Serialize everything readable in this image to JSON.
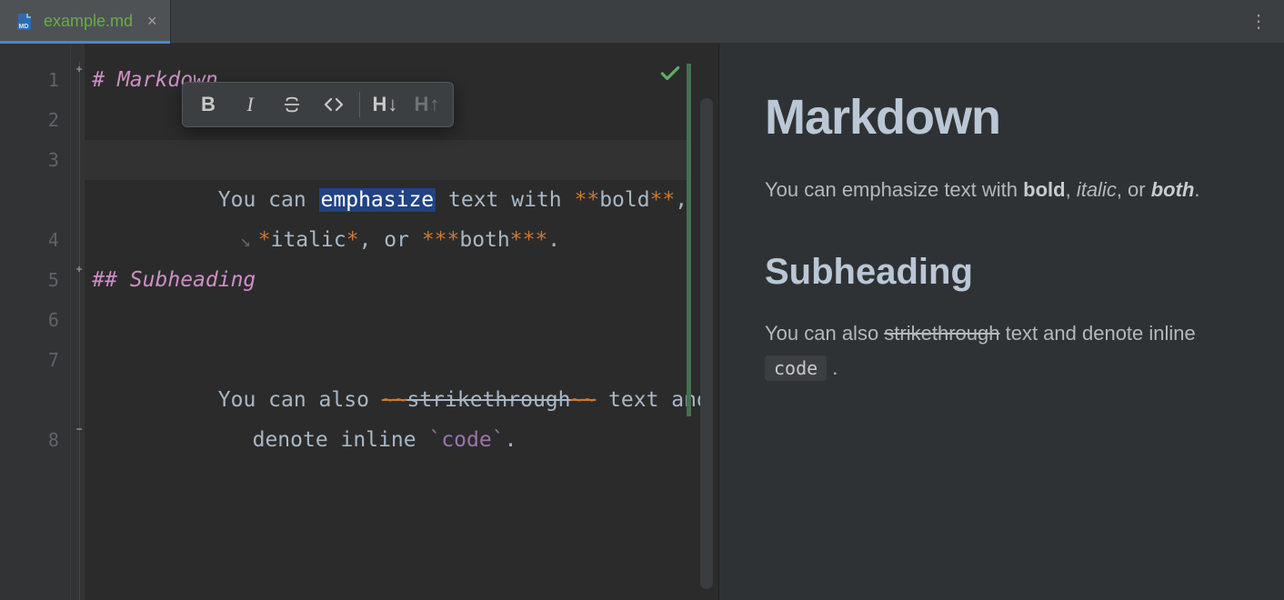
{
  "tabbar": {
    "file_name": "example.md"
  },
  "toolbar": {
    "bold": "B",
    "italic": "I",
    "strike": "S",
    "code": "<>",
    "h_down": "H↓",
    "h_up": "H↑"
  },
  "editor": {
    "line_numbers": [
      "1",
      "2",
      "3",
      "4",
      "5",
      "6",
      "7",
      "8"
    ],
    "line1_heading": "# Markdown",
    "line3a_pre": "You can ",
    "line3a_sel": "emphasize",
    "line3a_mid": " text with ",
    "line3a_mk1": "**",
    "line3a_bold": "bold",
    "line3a_mk2": "**",
    "line3a_tail": ",",
    "line3b_mk1": "*",
    "line3b_italic": "italic",
    "line3b_mk2": "*",
    "line3b_mid": ", or ",
    "line3b_mk3": "***",
    "line3b_both": "both",
    "line3b_mk4": "***",
    "line3b_tail": ".",
    "line5_heading": "## Subheading",
    "line7a_pre": "You can also ",
    "line7a_mk1": "~~",
    "line7a_strike": "strikethrough",
    "line7a_mk2": "~~",
    "line7a_tail": " text and",
    "line7b_pre": " denote inline ",
    "line7b_mk1": "`",
    "line7b_code": "code",
    "line7b_mk2": "`",
    "line7b_tail": "."
  },
  "preview": {
    "h1": "Markdown",
    "p1_pre": "You can emphasize text with ",
    "p1_bold": "bold",
    "p1_sep1": ", ",
    "p1_italic": "italic",
    "p1_sep2": ", or ",
    "p1_both": "both",
    "p1_tail": ".",
    "h2": "Subheading",
    "p2_pre": "You can also ",
    "p2_strike": "strikethrough",
    "p2_mid": " text and denote inline ",
    "p2_code": "code",
    "p2_tail": " ."
  }
}
